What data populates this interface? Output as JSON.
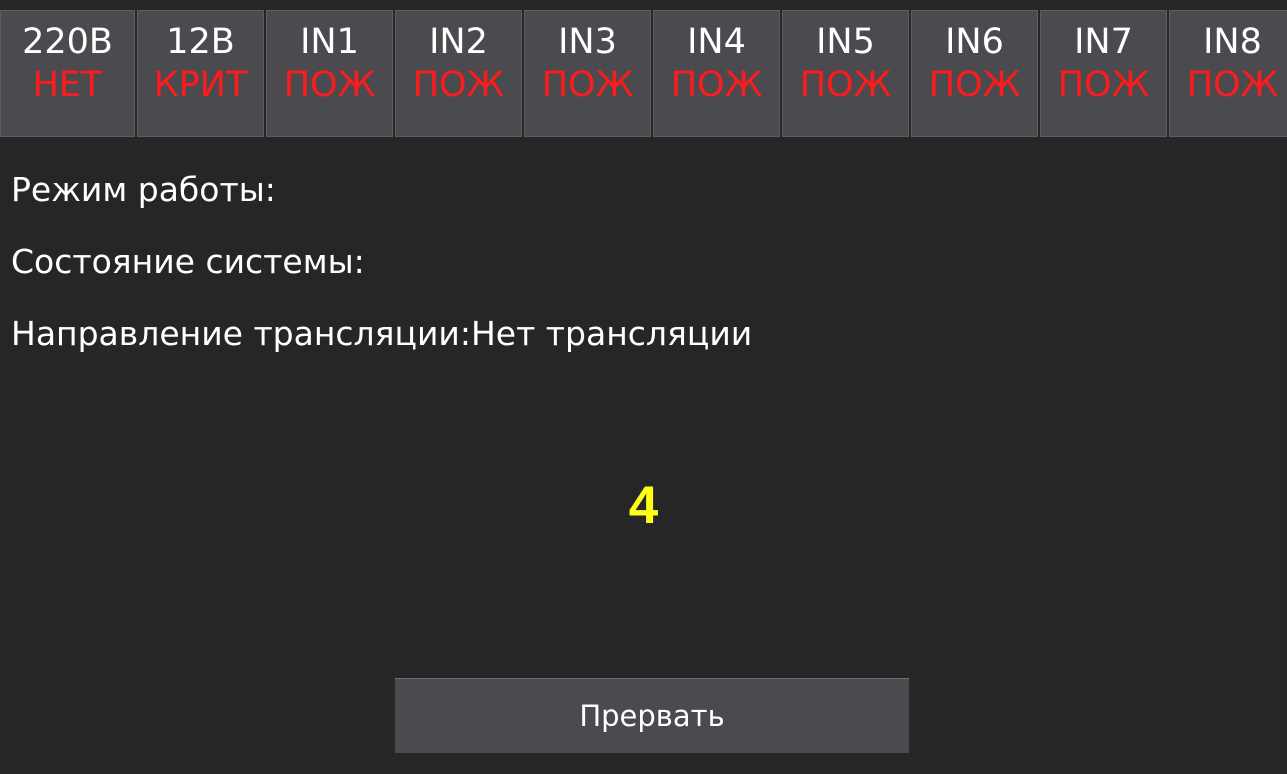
{
  "status_indicators": [
    {
      "label": "220В",
      "state": "НЕТ"
    },
    {
      "label": "12В",
      "state": "КРИТ"
    },
    {
      "label": "IN1",
      "state": "ПОЖ"
    },
    {
      "label": "IN2",
      "state": "ПОЖ"
    },
    {
      "label": "IN3",
      "state": "ПОЖ"
    },
    {
      "label": "IN4",
      "state": "ПОЖ"
    },
    {
      "label": "IN5",
      "state": "ПОЖ"
    },
    {
      "label": "IN6",
      "state": "ПОЖ"
    },
    {
      "label": "IN7",
      "state": "ПОЖ"
    },
    {
      "label": "IN8",
      "state": "ПОЖ"
    }
  ],
  "info": {
    "mode_label": "Режим работы:",
    "system_state_label": "Состояние системы:",
    "direction_line": "Направление трансляции:Нет трансляции"
  },
  "counter": {
    "value": "4"
  },
  "actions": {
    "abort_label": "Прервать"
  },
  "colors": {
    "background": "#262626",
    "cell_background": "#4a4a4f",
    "alert_text": "#ff1b1b",
    "counter_text": "#ffff16",
    "normal_text": "#ffffff"
  }
}
